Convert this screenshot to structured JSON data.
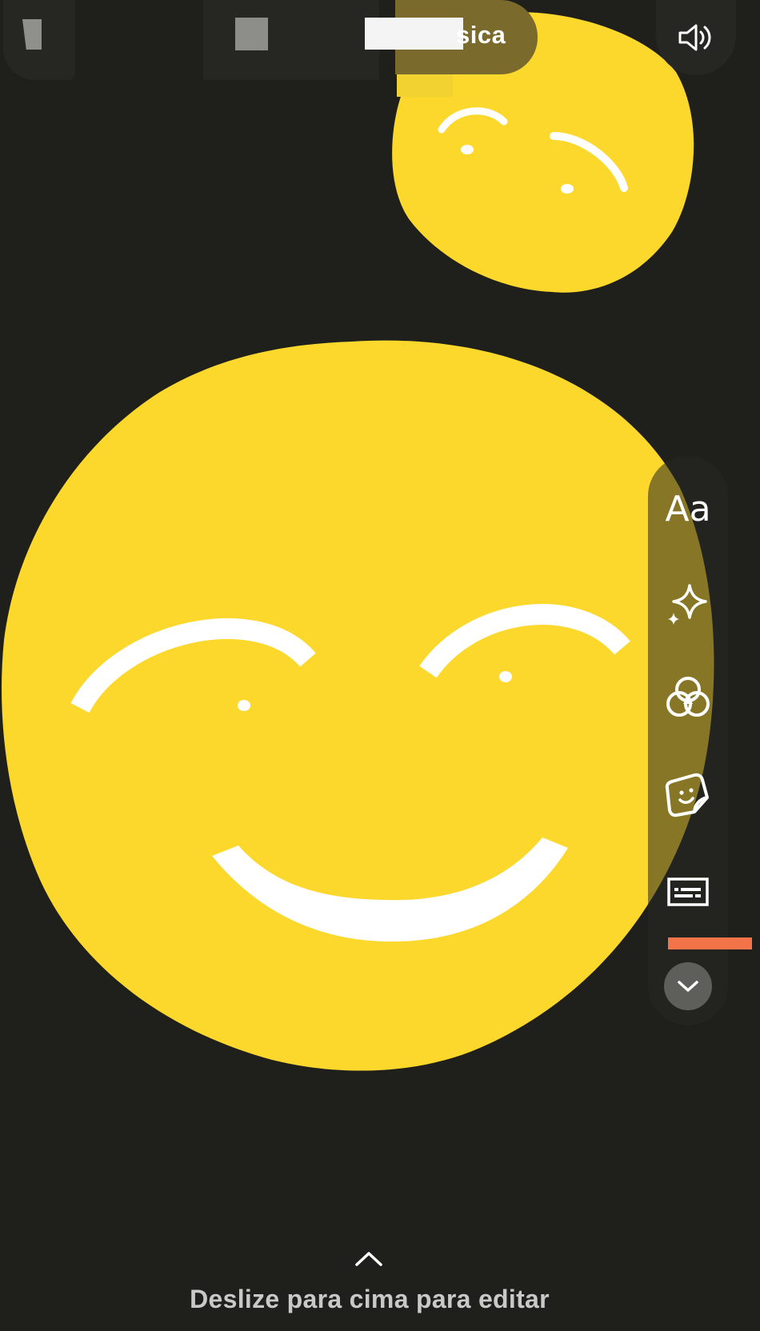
{
  "top_bar": {
    "music_label": "sica",
    "sound_icon": "speaker-volume-icon"
  },
  "tools": [
    {
      "id": "text",
      "label": "Aa",
      "icon": "text-icon"
    },
    {
      "id": "effects",
      "label": "",
      "icon": "sparkle-icon"
    },
    {
      "id": "filters",
      "label": "",
      "icon": "filters-icon"
    },
    {
      "id": "stickers",
      "label": "",
      "icon": "sticker-icon"
    },
    {
      "id": "captions",
      "label": "",
      "icon": "captions-icon"
    }
  ],
  "collapse_icon": "chevron-down-icon",
  "bottom": {
    "swipe_icon": "chevron-up-icon",
    "hint": "Deslize para cima para editar"
  },
  "colors": {
    "background": "#1f201b",
    "emoji_yellow": "#fcd72c",
    "emoji_features": "#ffffff",
    "accent_orange": "#f4744a",
    "panel": "#262723"
  }
}
